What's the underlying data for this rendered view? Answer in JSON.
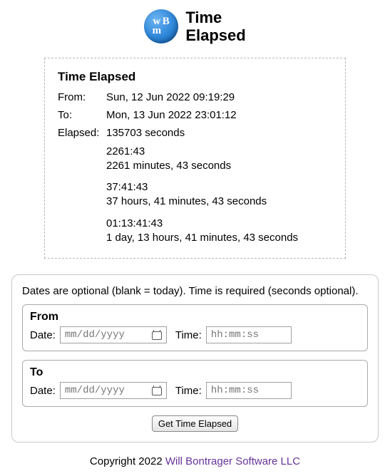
{
  "header": {
    "title_line1": "Time",
    "title_line2": "Elapsed",
    "logo_letters": [
      "w",
      "B",
      "m",
      ""
    ]
  },
  "results": {
    "title": "Time Elapsed",
    "from_label": "From:",
    "from_value": "Sun, 12 Jun 2022 09:19:29",
    "to_label": "To:",
    "to_value": "Mon, 13 Jun 2022 23:01:12",
    "elapsed_label": "Elapsed:",
    "elapsed_seconds": "135703 seconds",
    "blocks": [
      {
        "short": "2261:43",
        "long": "2261 minutes, 43 seconds"
      },
      {
        "short": "37:41:43",
        "long": "37 hours, 41 minutes, 43 seconds"
      },
      {
        "short": "01:13:41:43",
        "long": "1 day, 13 hours, 41 minutes, 43 seconds"
      }
    ]
  },
  "form": {
    "hint": "Dates are optional (blank = today). Time is required (seconds optional).",
    "from_title": "From",
    "to_title": "To",
    "date_label": "Date:",
    "time_label": "Time:",
    "date_placeholder": "mm/dd/yyyy",
    "time_placeholder": "hh:mm:ss",
    "submit_label": "Get Time Elapsed"
  },
  "footer": {
    "prefix": "Copyright 2022 ",
    "link_text": "Will Bontrager Software LLC"
  }
}
